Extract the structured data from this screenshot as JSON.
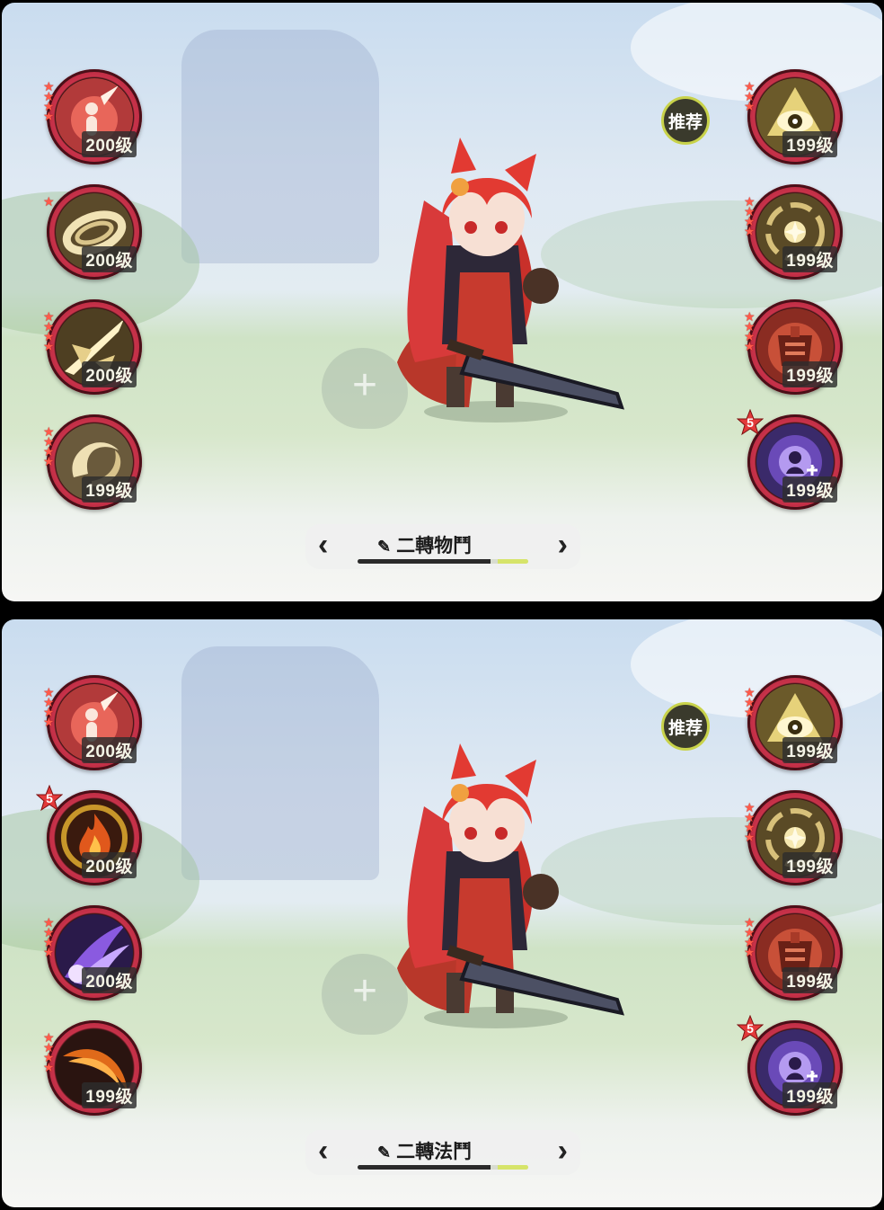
{
  "panels": [
    {
      "id": "top",
      "left_skills": [
        {
          "icon": "sword-strike-icon",
          "level": "200级",
          "stars": 4
        },
        {
          "icon": "wind-slash-icon",
          "level": "200级",
          "stars": 1
        },
        {
          "icon": "light-blade-icon",
          "level": "200级",
          "stars": 4
        },
        {
          "icon": "whirlwind-icon",
          "level": "199级",
          "stars": 4
        }
      ],
      "right_skills": [
        {
          "icon": "eye-icon",
          "level": "199级",
          "stars": 3
        },
        {
          "icon": "vortex-icon",
          "level": "199级",
          "stars": 4
        },
        {
          "icon": "armor-icon",
          "level": "199级",
          "stars": 4
        },
        {
          "icon": "arcane-orb-icon",
          "level": "199级",
          "stars": 0,
          "badge": "5"
        }
      ],
      "recommend_label": "推荐",
      "plus_label": "+",
      "switcher": {
        "prev": "‹",
        "next": "›",
        "pen": "✎",
        "label": "二轉物鬥",
        "progress": 0.78
      }
    },
    {
      "id": "bottom",
      "left_skills": [
        {
          "icon": "sword-strike-icon",
          "level": "200级",
          "stars": 4
        },
        {
          "icon": "flame-icon",
          "level": "200级",
          "stars": 0,
          "badge": "5"
        },
        {
          "icon": "shadow-claw-icon",
          "level": "200级",
          "stars": 4
        },
        {
          "icon": "fire-slash-icon",
          "level": "199级",
          "stars": 4
        }
      ],
      "right_skills": [
        {
          "icon": "eye-icon",
          "level": "199级",
          "stars": 3
        },
        {
          "icon": "vortex-icon",
          "level": "199级",
          "stars": 4
        },
        {
          "icon": "armor-icon",
          "level": "199级",
          "stars": 4
        },
        {
          "icon": "arcane-orb-icon",
          "level": "199级",
          "stars": 0,
          "badge": "5"
        }
      ],
      "recommend_label": "推荐",
      "plus_label": "+",
      "switcher": {
        "prev": "‹",
        "next": "›",
        "pen": "✎",
        "label": "二轉法鬥",
        "progress": 0.78
      }
    }
  ],
  "colors": {
    "ring_red": "#c8324a",
    "star_red": "#ff5a4a",
    "level_bg": "#2d2d2d",
    "recommend_ring": "#c8d24a",
    "progress_accent": "#d6e46a"
  }
}
